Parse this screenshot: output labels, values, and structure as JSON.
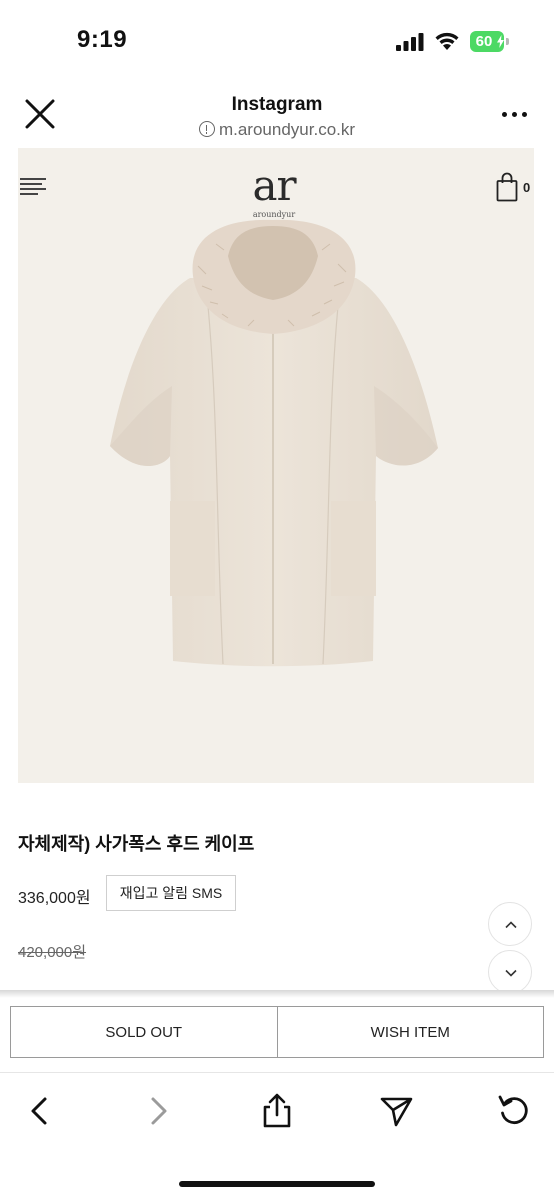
{
  "status_bar": {
    "time": "9:19",
    "battery_level": "60",
    "icons": [
      "cellular-signal-icon",
      "wifi-icon",
      "battery-charging-icon"
    ]
  },
  "browser_header": {
    "title": "Instagram",
    "url": "m.aroundyur.co.kr",
    "icons": [
      "close-icon",
      "info-icon",
      "more-dots-icon"
    ]
  },
  "shop": {
    "logo_mark": "ar",
    "logo_text": "aroundyur",
    "cart_count": "0",
    "icons": [
      "hamburger-menu-icon",
      "shopping-bag-icon"
    ]
  },
  "product": {
    "name": "자체제작) 사가폭스 후드 케이프",
    "price": "336,000원",
    "original_price": "420,000원",
    "restock_button": "재입고 알림 SMS",
    "image_description_icon": "fur-hood-cape-image"
  },
  "actions": {
    "sold_out": "SOLD OUT",
    "wish_item": "WISH ITEM"
  },
  "toolbar": {
    "icons": [
      "back-arrow-icon",
      "forward-arrow-icon",
      "share-icon",
      "send-icon",
      "reload-icon"
    ]
  },
  "colors": {
    "hero_background": "#f3f0ea",
    "battery_green": "#4cd964",
    "cape_beige": "#e6ddd1"
  }
}
